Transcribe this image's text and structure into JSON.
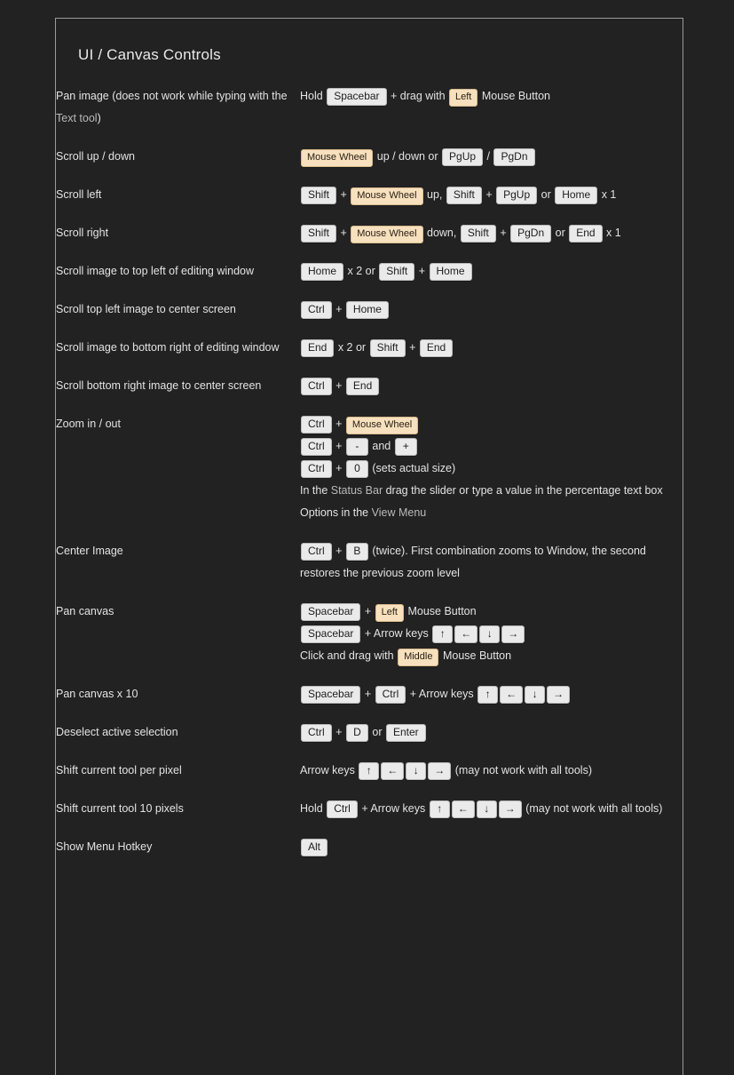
{
  "page": {
    "background": "#222222",
    "panel_border": "#9a9a9a",
    "text_color": "#e3e3e4",
    "key_bg": "#eaeaea",
    "key_border": "#b9b9b9",
    "key_text": "#1d1d1d",
    "mouse_bg": "#f7e0bd",
    "mouse_border": "#d8b98d",
    "link_color": "#b9b9bb"
  },
  "heading": "UI / Canvas Controls",
  "rows": [
    {
      "id": "pan-image",
      "term_parts": [
        {
          "t": "text",
          "v": "Pan image (does not work while typing with the "
        },
        {
          "t": "link",
          "v": "Text tool"
        },
        {
          "t": "text",
          "v": ")"
        }
      ],
      "term_plain": "Pan image (does not work while typing with the Text tool)",
      "lines": [
        [
          {
            "t": "text",
            "v": "Hold "
          },
          {
            "t": "key",
            "v": "Spacebar"
          },
          {
            "t": "text",
            "v": " + drag with "
          },
          {
            "t": "mouse",
            "v": "Left"
          },
          {
            "t": "text",
            "v": " Mouse Button"
          }
        ]
      ]
    },
    {
      "id": "scroll-up-down",
      "term_plain": "Scroll up / down",
      "term_parts": [
        {
          "t": "text",
          "v": "Scroll up / down"
        }
      ],
      "lines": [
        [
          {
            "t": "mouse",
            "v": "Mouse Wheel"
          },
          {
            "t": "text",
            "v": " up / down or "
          },
          {
            "t": "key",
            "v": "PgUp"
          },
          {
            "t": "text",
            "v": " / "
          },
          {
            "t": "key",
            "v": "PgDn"
          }
        ]
      ]
    },
    {
      "id": "scroll-left",
      "term_plain": "Scroll left",
      "term_parts": [
        {
          "t": "text",
          "v": "Scroll left"
        }
      ],
      "lines": [
        [
          {
            "t": "key",
            "v": "Shift"
          },
          {
            "t": "text",
            "v": " + "
          },
          {
            "t": "mouse",
            "v": "Mouse Wheel"
          },
          {
            "t": "text",
            "v": " up, "
          },
          {
            "t": "key",
            "v": "Shift"
          },
          {
            "t": "text",
            "v": " + "
          },
          {
            "t": "key",
            "v": "PgUp"
          },
          {
            "t": "text",
            "v": " or "
          },
          {
            "t": "key",
            "v": "Home"
          },
          {
            "t": "text",
            "v": " x 1"
          }
        ]
      ]
    },
    {
      "id": "scroll-right",
      "term_plain": "Scroll right",
      "term_parts": [
        {
          "t": "text",
          "v": "Scroll right"
        }
      ],
      "lines": [
        [
          {
            "t": "key",
            "v": "Shift"
          },
          {
            "t": "text",
            "v": " + "
          },
          {
            "t": "mouse",
            "v": "Mouse Wheel"
          },
          {
            "t": "text",
            "v": " down, "
          },
          {
            "t": "key",
            "v": "Shift"
          },
          {
            "t": "text",
            "v": " + "
          },
          {
            "t": "key",
            "v": "PgDn"
          },
          {
            "t": "text",
            "v": " or "
          },
          {
            "t": "key",
            "v": "End"
          },
          {
            "t": "text",
            "v": " x 1"
          }
        ]
      ]
    },
    {
      "id": "scroll-top-left",
      "term_plain": "Scroll image to top left of editing window",
      "term_parts": [
        {
          "t": "text",
          "v": "Scroll image to top left of editing window"
        }
      ],
      "lines": [
        [
          {
            "t": "key",
            "v": "Home"
          },
          {
            "t": "text",
            "v": " x 2 or "
          },
          {
            "t": "key",
            "v": "Shift"
          },
          {
            "t": "text",
            "v": " + "
          },
          {
            "t": "key",
            "v": "Home"
          }
        ]
      ]
    },
    {
      "id": "scroll-top-left-center",
      "term_plain": "Scroll top left image to center screen",
      "term_parts": [
        {
          "t": "text",
          "v": "Scroll top left image to center screen"
        }
      ],
      "lines": [
        [
          {
            "t": "key",
            "v": "Ctrl"
          },
          {
            "t": "text",
            "v": " + "
          },
          {
            "t": "key",
            "v": "Home"
          }
        ]
      ]
    },
    {
      "id": "scroll-bottom-right",
      "term_plain": "Scroll image to bottom right of editing window",
      "term_parts": [
        {
          "t": "text",
          "v": "Scroll image to bottom right of editing window"
        }
      ],
      "lines": [
        [
          {
            "t": "key",
            "v": "End"
          },
          {
            "t": "text",
            "v": " x 2 or "
          },
          {
            "t": "key",
            "v": "Shift"
          },
          {
            "t": "text",
            "v": " + "
          },
          {
            "t": "key",
            "v": "End"
          }
        ]
      ]
    },
    {
      "id": "scroll-bottom-right-center",
      "term_plain": "Scroll bottom right image to center screen",
      "term_parts": [
        {
          "t": "text",
          "v": "Scroll bottom right image to center screen"
        }
      ],
      "lines": [
        [
          {
            "t": "key",
            "v": "Ctrl"
          },
          {
            "t": "text",
            "v": " + "
          },
          {
            "t": "key",
            "v": "End"
          }
        ]
      ]
    },
    {
      "id": "zoom-in-out",
      "term_plain": "Zoom in / out",
      "term_parts": [
        {
          "t": "text",
          "v": "Zoom in / out"
        }
      ],
      "lines": [
        [
          {
            "t": "key",
            "v": "Ctrl"
          },
          {
            "t": "text",
            "v": " + "
          },
          {
            "t": "mouse",
            "v": "Mouse Wheel"
          }
        ],
        [
          {
            "t": "key",
            "v": "Ctrl"
          },
          {
            "t": "text",
            "v": " + "
          },
          {
            "t": "key",
            "v": "-"
          },
          {
            "t": "text",
            "v": " and "
          },
          {
            "t": "key",
            "v": "+"
          }
        ],
        [
          {
            "t": "key",
            "v": "Ctrl"
          },
          {
            "t": "text",
            "v": " + "
          },
          {
            "t": "key",
            "v": "0"
          },
          {
            "t": "text",
            "v": " (sets actual size)"
          }
        ],
        [
          {
            "t": "text",
            "v": "In the "
          },
          {
            "t": "link",
            "v": "Status Bar"
          },
          {
            "t": "text",
            "v": " drag the slider or type a value in the percentage text box"
          }
        ],
        [
          {
            "t": "text",
            "v": "Options in the "
          },
          {
            "t": "link",
            "v": "View Menu"
          }
        ]
      ]
    },
    {
      "id": "center-image",
      "term_plain": "Center Image",
      "term_parts": [
        {
          "t": "text",
          "v": "Center Image"
        }
      ],
      "lines": [
        [
          {
            "t": "key",
            "v": "Ctrl"
          },
          {
            "t": "text",
            "v": " + "
          },
          {
            "t": "key",
            "v": "B"
          },
          {
            "t": "text",
            "v": " (twice). First combination zooms to Window, the second restores the previous zoom level"
          }
        ]
      ]
    },
    {
      "id": "pan-canvas",
      "term_plain": "Pan canvas",
      "term_parts": [
        {
          "t": "text",
          "v": "Pan canvas"
        }
      ],
      "lines": [
        [
          {
            "t": "key",
            "v": "Spacebar"
          },
          {
            "t": "text",
            "v": " + "
          },
          {
            "t": "mouse",
            "v": "Left"
          },
          {
            "t": "text",
            "v": " Mouse Button"
          }
        ],
        [
          {
            "t": "key",
            "v": "Spacebar"
          },
          {
            "t": "text",
            "v": " + Arrow keys "
          },
          {
            "t": "arrow",
            "v": "↑"
          },
          {
            "t": "arrow",
            "v": "←"
          },
          {
            "t": "arrow",
            "v": "↓"
          },
          {
            "t": "arrow",
            "v": "→"
          }
        ],
        [
          {
            "t": "text",
            "v": "Click and drag with "
          },
          {
            "t": "mouse",
            "v": "Middle"
          },
          {
            "t": "text",
            "v": " Mouse Button"
          }
        ]
      ]
    },
    {
      "id": "pan-canvas-x10",
      "term_plain": "Pan canvas x 10",
      "term_parts": [
        {
          "t": "text",
          "v": "Pan canvas x 10"
        }
      ],
      "lines": [
        [
          {
            "t": "key",
            "v": "Spacebar"
          },
          {
            "t": "text",
            "v": " + "
          },
          {
            "t": "key",
            "v": "Ctrl"
          },
          {
            "t": "text",
            "v": " + Arrow keys "
          },
          {
            "t": "arrow",
            "v": "↑"
          },
          {
            "t": "arrow",
            "v": "←"
          },
          {
            "t": "arrow",
            "v": "↓"
          },
          {
            "t": "arrow",
            "v": "→"
          }
        ]
      ]
    },
    {
      "id": "deselect",
      "term_plain": "Deselect active selection",
      "term_parts": [
        {
          "t": "text",
          "v": "Deselect active selection"
        }
      ],
      "lines": [
        [
          {
            "t": "key",
            "v": "Ctrl"
          },
          {
            "t": "text",
            "v": " + "
          },
          {
            "t": "key",
            "v": "D"
          },
          {
            "t": "text",
            "v": " or "
          },
          {
            "t": "key",
            "v": "Enter"
          }
        ]
      ]
    },
    {
      "id": "shift-tool-per-pixel",
      "term_plain": "Shift current tool per pixel",
      "term_parts": [
        {
          "t": "text",
          "v": "Shift current tool per pixel"
        }
      ],
      "lines": [
        [
          {
            "t": "text",
            "v": "Arrow keys "
          },
          {
            "t": "arrow",
            "v": "↑"
          },
          {
            "t": "arrow",
            "v": "←"
          },
          {
            "t": "arrow",
            "v": "↓"
          },
          {
            "t": "arrow",
            "v": "→"
          },
          {
            "t": "text",
            "v": " (may not work with all tools)"
          }
        ]
      ]
    },
    {
      "id": "shift-tool-10-pixels",
      "term_plain": "Shift current tool 10 pixels",
      "term_parts": [
        {
          "t": "text",
          "v": "Shift current tool 10 pixels"
        }
      ],
      "lines": [
        [
          {
            "t": "text",
            "v": "Hold "
          },
          {
            "t": "key",
            "v": "Ctrl"
          },
          {
            "t": "text",
            "v": " + Arrow keys "
          },
          {
            "t": "arrow",
            "v": "↑"
          },
          {
            "t": "arrow",
            "v": "←"
          },
          {
            "t": "arrow",
            "v": "↓"
          },
          {
            "t": "arrow",
            "v": "→"
          },
          {
            "t": "text",
            "v": " (may not work with all tools)"
          }
        ]
      ]
    },
    {
      "id": "show-menu-hotkey",
      "term_plain": "Show Menu Hotkey",
      "term_parts": [
        {
          "t": "text",
          "v": "Show Menu Hotkey"
        }
      ],
      "lines": [
        [
          {
            "t": "key",
            "v": "Alt"
          }
        ]
      ]
    }
  ]
}
